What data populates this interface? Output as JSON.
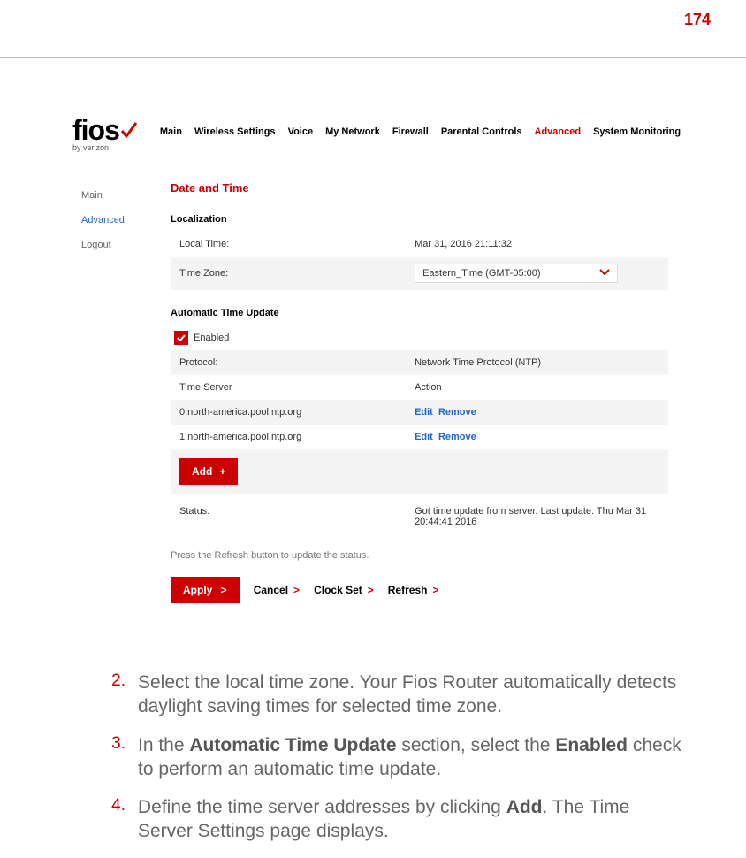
{
  "page_number": "174",
  "logo": {
    "text": "fios",
    "sub": "by verizon"
  },
  "topnav": {
    "items": [
      "Main",
      "Wireless Settings",
      "Voice",
      "My Network",
      "Firewall",
      "Parental Controls",
      "Advanced",
      "System Monitoring"
    ],
    "active_index": 6
  },
  "sidebar": {
    "items": [
      "Main",
      "Advanced",
      "Logout"
    ],
    "active_index": 1
  },
  "content": {
    "title": "Date and Time",
    "localization_section": "Localization",
    "local_time_label": "Local Time:",
    "local_time_value": "Mar 31, 2016 21:11:32",
    "time_zone_label": "Time Zone:",
    "time_zone_value": "Eastern_Time (GMT-05:00)",
    "auto_section": "Automatic Time Update",
    "enabled_label": "Enabled",
    "protocol_label": "Protocol:",
    "protocol_value": "Network Time Protocol (NTP)",
    "server_header": "Time Server",
    "action_header": "Action",
    "servers": [
      "0.north-america.pool.ntp.org",
      "1.north-america.pool.ntp.org"
    ],
    "edit_label": "Edit",
    "remove_label": "Remove",
    "add_label": "Add",
    "status_label": "Status:",
    "status_value": "Got time update from server. Last update: Thu Mar 31 20:44:41 2016",
    "refresh_note": "Press the Refresh button to update the status.",
    "apply_label": "Apply",
    "cancel_label": "Cancel",
    "clockset_label": "Clock Set",
    "refresh_label": "Refresh"
  },
  "instructions": {
    "items": [
      {
        "num": "2.",
        "text_a": "Select the local time zone. Your Fios Router automatically detects daylight saving times for selected time zone."
      },
      {
        "num": "3.",
        "text_b1": "In the ",
        "bold_b1": "Automatic Time Update",
        "text_b2": " section, select the ",
        "bold_b2": "Enabled",
        "text_b3": " check to perform an automatic time update."
      },
      {
        "num": "4.",
        "text_c1": "Define the time server addresses by clicking ",
        "bold_c1": "Add",
        "text_c2": ". The Time Server Settings page displays."
      }
    ]
  }
}
